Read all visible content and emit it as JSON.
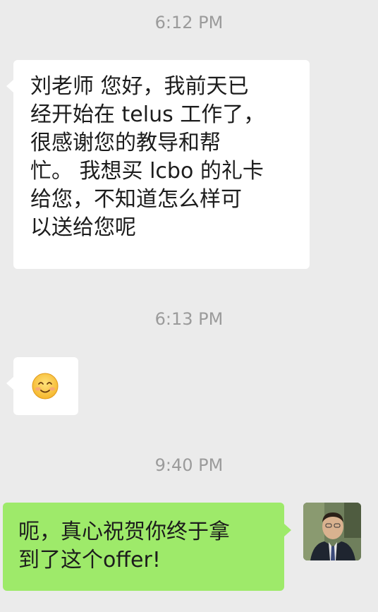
{
  "chat": {
    "timestamps": [
      "6:12 PM",
      "6:13 PM",
      "9:40 PM"
    ],
    "messages": [
      {
        "side": "left",
        "text": "刘老师 您好，我前天已\n经开始在 telus 工作了，\n很感谢您的教导和帮\n忙。 我想买 lcbo 的礼卡\n给您，不知道怎么样可\n以送给您呢"
      },
      {
        "side": "left",
        "emoji": "smiling-face-emoji"
      },
      {
        "side": "right",
        "text": "呃，真心祝贺你终于拿\n到了这个offer!"
      }
    ]
  },
  "colors": {
    "background": "#ebebeb",
    "incoming_bubble": "#ffffff",
    "outgoing_bubble": "#9eea6a",
    "timestamp_text": "#9b9b9b"
  }
}
